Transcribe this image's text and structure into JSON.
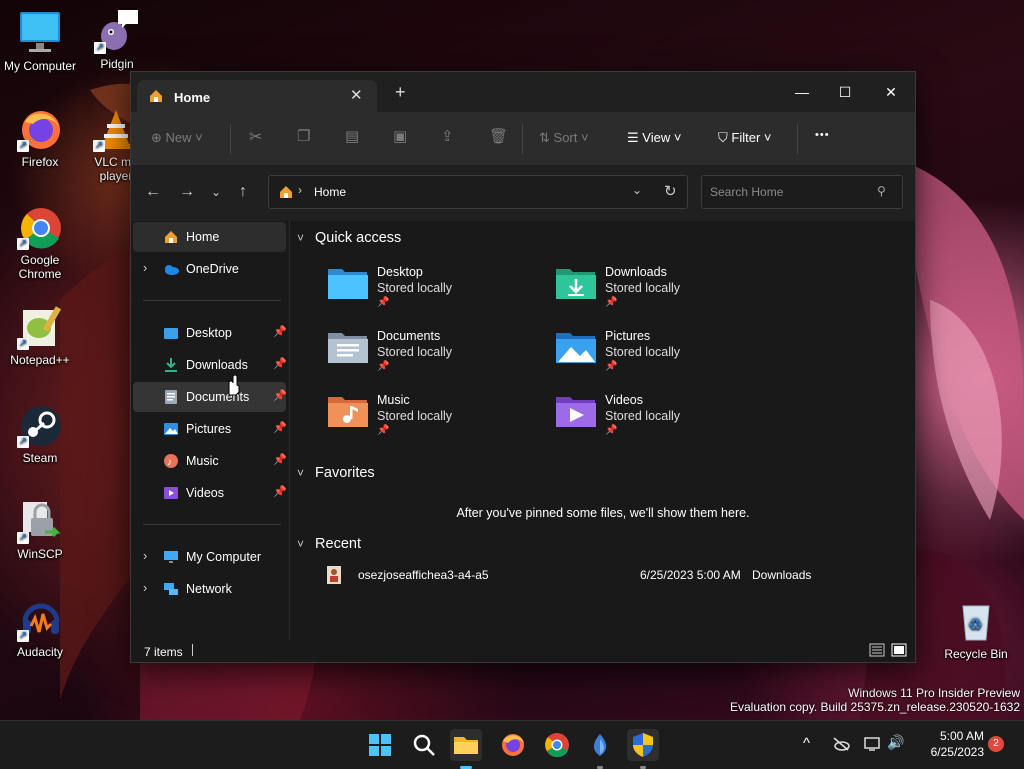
{
  "desktop": {
    "icons": [
      {
        "label": "My Computer"
      },
      {
        "label": "Pidgin"
      },
      {
        "label": "Firefox"
      },
      {
        "label": "VLC media player"
      },
      {
        "label": "Google Chrome"
      },
      {
        "label": "Notepad++"
      },
      {
        "label": "Steam"
      },
      {
        "label": "WinSCP"
      },
      {
        "label": "Audacity"
      },
      {
        "label": "Recycle Bin"
      }
    ],
    "vlc_line1": "VLC me",
    "vlc_line2": "player",
    "chrome_line1": "Google",
    "chrome_line2": "Chrome"
  },
  "window": {
    "tab_title": "Home",
    "new_tab_glyph": "+",
    "close_tab_glyph": "✕",
    "controls": {
      "minimize": "—",
      "maximize": "☐",
      "close": "✕"
    },
    "toolbar": {
      "new_label": "New",
      "sort_label": "Sort",
      "view_label": "View",
      "filter_label": "Filter",
      "more_glyph": "•••"
    },
    "address": {
      "path_label": "Home"
    },
    "search": {
      "placeholder": "Search Home"
    },
    "sidebar": {
      "home": "Home",
      "onedrive": "OneDrive",
      "desktop": "Desktop",
      "downloads": "Downloads",
      "documents": "Documents",
      "pictures": "Pictures",
      "music": "Music",
      "videos": "Videos",
      "my_computer": "My Computer",
      "network": "Network"
    },
    "quick_access": {
      "title": "Quick access",
      "items": [
        {
          "name": "Desktop",
          "status": "Stored locally"
        },
        {
          "name": "Downloads",
          "status": "Stored locally"
        },
        {
          "name": "Documents",
          "status": "Stored locally"
        },
        {
          "name": "Pictures",
          "status": "Stored locally"
        },
        {
          "name": "Music",
          "status": "Stored locally"
        },
        {
          "name": "Videos",
          "status": "Stored locally"
        }
      ]
    },
    "favorites": {
      "title": "Favorites",
      "empty_message": "After you've pinned some files, we'll show them here."
    },
    "recent": {
      "title": "Recent",
      "items": [
        {
          "name": "osezjoseaffichea3-a4-a5",
          "date": "6/25/2023 5:00 AM",
          "location": "Downloads"
        }
      ]
    },
    "status": {
      "items_count": "7 items"
    }
  },
  "watermark": {
    "line1": "Windows 11 Pro Insider Preview",
    "line2": "Evaluation copy. Build 25375.zn_release.230520-1632"
  },
  "taskbar": {
    "time": "5:00 AM",
    "date": "6/25/2023",
    "notification_count": "2",
    "overflow_glyph": "^"
  },
  "colors": {
    "accent": "#4cc2ff",
    "folder_blue": "#3aa0e8",
    "folder_green": "#2fb38a",
    "badge": "#e0493b"
  }
}
